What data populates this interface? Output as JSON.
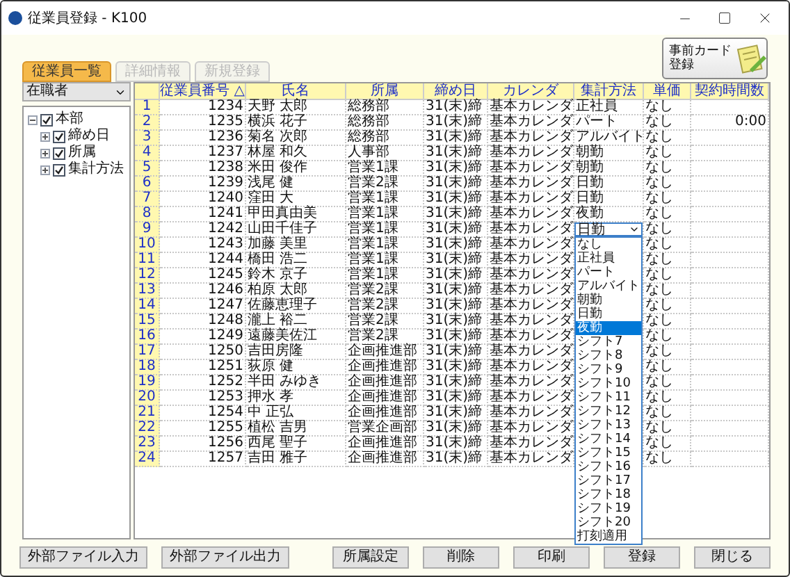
{
  "window": {
    "title": "従業員登録 - K100"
  },
  "tabs": [
    {
      "label": "従業員一覧",
      "selected": true,
      "disabled": false
    },
    {
      "label": "詳細情報",
      "selected": false,
      "disabled": true
    },
    {
      "label": "新規登録",
      "selected": false,
      "disabled": true
    }
  ],
  "card_button": {
    "label": "事前カード登録"
  },
  "filter": {
    "value": "在職者"
  },
  "tree": [
    {
      "label": "本部",
      "checked": true,
      "expanded": true,
      "children": [
        {
          "label": "締め日",
          "checked": true,
          "expanded": false
        },
        {
          "label": "所属",
          "checked": true,
          "expanded": false
        },
        {
          "label": "集計方法",
          "checked": true,
          "expanded": false
        }
      ]
    }
  ],
  "table": {
    "columns": [
      "",
      "従業員番号 △",
      "氏名",
      "所属",
      "締め日",
      "カレンダ",
      "集計方法",
      "単価",
      "契約時間数"
    ],
    "rows": [
      {
        "no": "1",
        "id": "1234",
        "name": "天野 太郎",
        "dept": "総務部",
        "close": "31(末)締",
        "calendar": "基本カレンダ",
        "method": "正社員",
        "price": "なし",
        "editing": false
      },
      {
        "no": "2",
        "id": "1235",
        "name": "横浜 花子",
        "dept": "総務部",
        "close": "31(末)締",
        "calendar": "基本カレンダ",
        "method": "パート",
        "price": "なし",
        "hours": "0:00",
        "editing": false
      },
      {
        "no": "3",
        "id": "1236",
        "name": "菊名 次郎",
        "dept": "総務部",
        "close": "31(末)締",
        "calendar": "基本カレンダ",
        "method": "アルバイト",
        "price": "なし",
        "editing": false
      },
      {
        "no": "4",
        "id": "1237",
        "name": "林屋 和久",
        "dept": "人事部",
        "close": "31(末)締",
        "calendar": "基本カレンダ",
        "method": "朝勤",
        "price": "なし",
        "editing": false
      },
      {
        "no": "5",
        "id": "1238",
        "name": "米田 俊作",
        "dept": "営業1課",
        "close": "31(末)締",
        "calendar": "基本カレンダ",
        "method": "朝勤",
        "price": "なし",
        "editing": false
      },
      {
        "no": "6",
        "id": "1239",
        "name": "浅尾 健",
        "dept": "営業2課",
        "close": "31(末)締",
        "calendar": "基本カレンダ",
        "method": "日勤",
        "price": "なし",
        "editing": false
      },
      {
        "no": "7",
        "id": "1240",
        "name": "窪田 大",
        "dept": "営業1課",
        "close": "31(末)締",
        "calendar": "基本カレンダ",
        "method": "日勤",
        "price": "なし",
        "editing": false
      },
      {
        "no": "8",
        "id": "1241",
        "name": "甲田真由美",
        "dept": "営業1課",
        "close": "31(末)締",
        "calendar": "基本カレンダ",
        "method": "夜勤",
        "price": "なし",
        "editing": false
      },
      {
        "no": "9",
        "id": "1242",
        "name": "山田千佳子",
        "dept": "営業1課",
        "close": "31(末)締",
        "calendar": "基本カレンダ",
        "method": "日勤",
        "price": "なし",
        "editing": true
      },
      {
        "no": "10",
        "id": "1243",
        "name": "加藤 美里",
        "dept": "営業1課",
        "close": "31(末)締",
        "calendar": "基本カレンダ",
        "price": "なし",
        "editing": false
      },
      {
        "no": "11",
        "id": "1244",
        "name": "橋田 浩二",
        "dept": "営業1課",
        "close": "31(末)締",
        "calendar": "基本カレンダ",
        "price": "なし",
        "editing": false
      },
      {
        "no": "12",
        "id": "1245",
        "name": "鈴木 京子",
        "dept": "営業1課",
        "close": "31(末)締",
        "calendar": "基本カレンダ",
        "price": "なし",
        "editing": false
      },
      {
        "no": "13",
        "id": "1246",
        "name": "柏原 太郎",
        "dept": "営業2課",
        "close": "31(末)締",
        "calendar": "基本カレンダ",
        "price": "なし",
        "editing": false
      },
      {
        "no": "14",
        "id": "1247",
        "name": "佐藤恵理子",
        "dept": "営業2課",
        "close": "31(末)締",
        "calendar": "基本カレンダ",
        "price": "なし",
        "editing": false
      },
      {
        "no": "15",
        "id": "1248",
        "name": "瀧上 裕二",
        "dept": "営業2課",
        "close": "31(末)締",
        "calendar": "基本カレンダ",
        "price": "なし",
        "editing": false
      },
      {
        "no": "16",
        "id": "1249",
        "name": "遠藤美佐江",
        "dept": "営業2課",
        "close": "31(末)締",
        "calendar": "基本カレンダ",
        "price": "なし",
        "editing": false
      },
      {
        "no": "17",
        "id": "1250",
        "name": "吉田房隆",
        "dept": "企画推進部",
        "close": "31(末)締",
        "calendar": "基本カレンダ",
        "price": "なし",
        "editing": false
      },
      {
        "no": "18",
        "id": "1251",
        "name": "荻原 健",
        "dept": "企画推進部",
        "close": "31(末)締",
        "calendar": "基本カレンダ",
        "price": "なし",
        "editing": false
      },
      {
        "no": "19",
        "id": "1252",
        "name": "半田 みゆき",
        "dept": "企画推進部",
        "close": "31(末)締",
        "calendar": "基本カレンダ",
        "price": "なし",
        "editing": false
      },
      {
        "no": "20",
        "id": "1253",
        "name": "押水 孝",
        "dept": "企画推進部",
        "close": "31(末)締",
        "calendar": "基本カレンダ",
        "price": "なし",
        "editing": false
      },
      {
        "no": "21",
        "id": "1254",
        "name": "中 正弘",
        "dept": "企画推進部",
        "close": "31(末)締",
        "calendar": "基本カレンダ",
        "price": "なし",
        "editing": false
      },
      {
        "no": "22",
        "id": "1255",
        "name": "植松 吉男",
        "dept": "営業企画部",
        "close": "31(末)締",
        "calendar": "基本カレンダ",
        "price": "なし",
        "editing": false
      },
      {
        "no": "23",
        "id": "1256",
        "name": "西尾 聖子",
        "dept": "企画推進部",
        "close": "31(末)締",
        "calendar": "基本カレンダ",
        "price": "なし",
        "editing": false
      },
      {
        "no": "24",
        "id": "1257",
        "name": "吉田 雅子",
        "dept": "企画推進部",
        "close": "31(末)締",
        "calendar": "基本カレンダ",
        "price": "なし",
        "editing": false
      }
    ]
  },
  "method_options": [
    {
      "label": "なし",
      "selected": false
    },
    {
      "label": "正社員",
      "selected": false
    },
    {
      "label": "パート",
      "selected": false
    },
    {
      "label": "アルバイト",
      "selected": false
    },
    {
      "label": "朝勤",
      "selected": false
    },
    {
      "label": "日勤",
      "selected": false
    },
    {
      "label": "夜勤",
      "selected": true
    },
    {
      "label": "シフト7",
      "selected": false
    },
    {
      "label": "シフト8",
      "selected": false
    },
    {
      "label": "シフト9",
      "selected": false
    },
    {
      "label": "シフト10",
      "selected": false
    },
    {
      "label": "シフト11",
      "selected": false
    },
    {
      "label": "シフト12",
      "selected": false
    },
    {
      "label": "シフト13",
      "selected": false
    },
    {
      "label": "シフト14",
      "selected": false
    },
    {
      "label": "シフト15",
      "selected": false
    },
    {
      "label": "シフト16",
      "selected": false
    },
    {
      "label": "シフト17",
      "selected": false
    },
    {
      "label": "シフト18",
      "selected": false
    },
    {
      "label": "シフト19",
      "selected": false
    },
    {
      "label": "シフト20",
      "selected": false
    },
    {
      "label": "打刻適用",
      "selected": false
    }
  ],
  "buttons_left": [
    "外部ファイル入力",
    "外部ファイル出力"
  ],
  "buttons_right": [
    "所属設定",
    "削除",
    "印刷",
    "登録",
    "閉じる"
  ]
}
